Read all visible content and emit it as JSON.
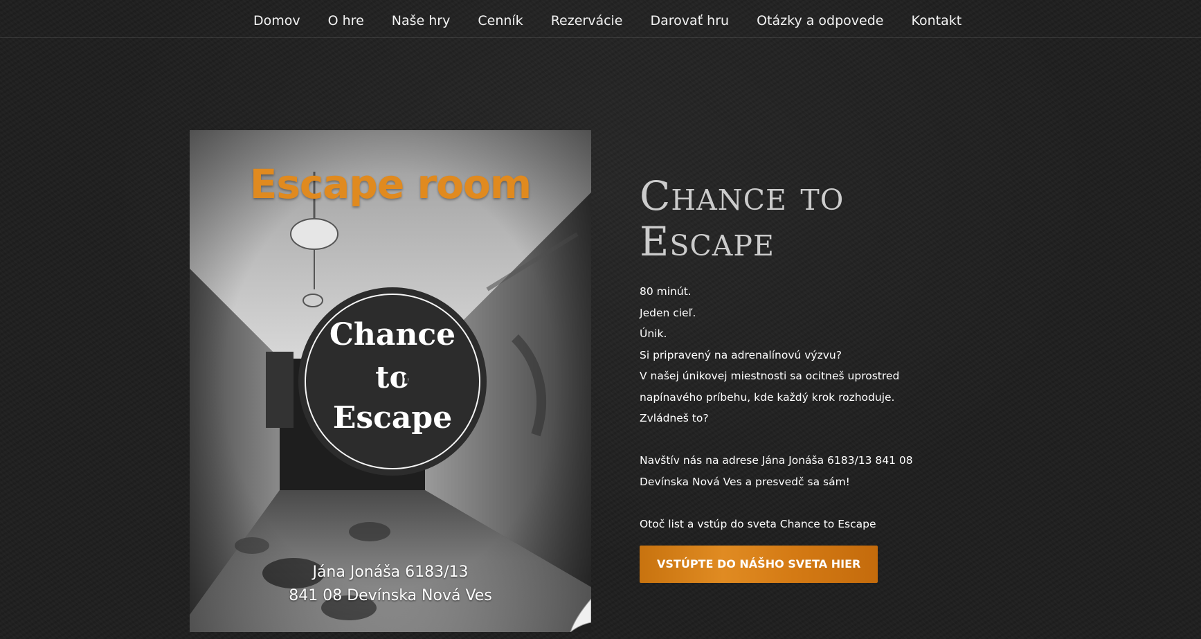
{
  "nav": {
    "items": [
      {
        "label": "Domov"
      },
      {
        "label": "O hre"
      },
      {
        "label": "Naše hry"
      },
      {
        "label": "Cenník"
      },
      {
        "label": "Rezervácie"
      },
      {
        "label": "Darovať hru"
      },
      {
        "label": "Otázky a odpovede"
      },
      {
        "label": "Kontakt"
      }
    ]
  },
  "poster": {
    "heading": "Escape room",
    "logo_line1": "Chance",
    "logo_line2": "to",
    "logo_line3": "Escape",
    "address_line1": "Jána Jonáša 6183/13",
    "address_line2": "841 08 Devínska Nová Ves"
  },
  "content": {
    "title": "Chance to Escape",
    "lines": [
      "80 minút.",
      "Jeden cieľ.",
      "Únik.",
      "Si pripravený na adrenalínovú výzvu?",
      "V našej únikovej miestnosti sa ocitneš uprostred",
      "napínavého príbehu, kde každý krok rozhoduje.",
      "Zvládneš to?"
    ],
    "visit_line1": "Navštív nás na adrese  Jána Jonáša 6183/13 841 08",
    "visit_line2": "Devínska Nová Ves a presvedč sa sám!",
    "turn_page": "Otoč list a vstúp do sveta Chance to Escape",
    "cta_label": "Vstúpte do nášho sveta hier"
  },
  "colors": {
    "accent": "#e08a1f",
    "background": "#1f1f1f",
    "title": "#cccccc"
  }
}
